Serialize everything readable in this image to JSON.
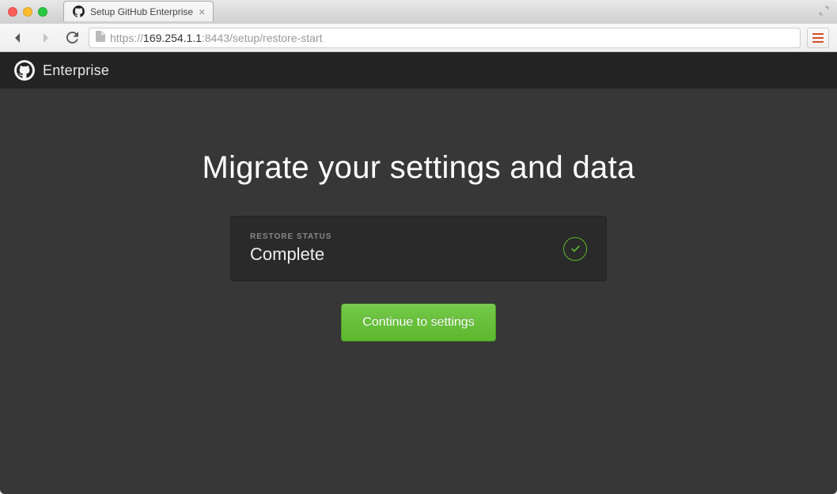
{
  "window": {
    "tab_title": "Setup GitHub Enterprise",
    "url_protocol": "https://",
    "url_host": "169.254.1.1",
    "url_port_path": ":8443/setup/restore-start"
  },
  "header": {
    "brand": "Enterprise"
  },
  "main": {
    "title": "Migrate your settings and data",
    "status_label": "RESTORE STATUS",
    "status_value": "Complete",
    "continue_label": "Continue to settings"
  }
}
